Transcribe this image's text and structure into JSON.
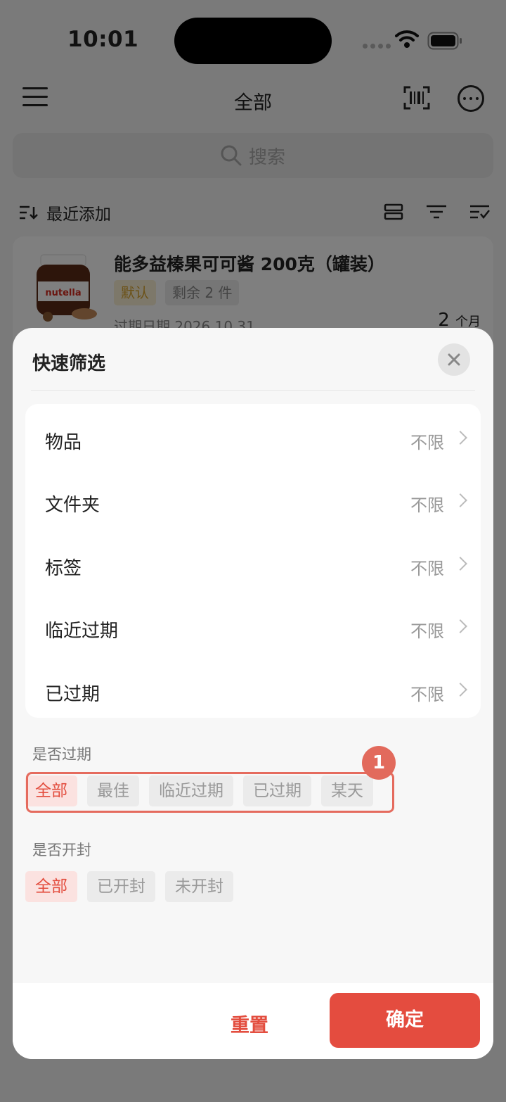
{
  "status": {
    "time": "10:01"
  },
  "nav": {
    "title": "全部"
  },
  "search": {
    "placeholder": "搜索"
  },
  "sort": {
    "label": "最近添加"
  },
  "item": {
    "title": "能多益榛果可可酱 200克（罐装）",
    "tag_default": "默认",
    "tag_remain": "剩余 2 件",
    "date": "过期日期 2026.10.31",
    "months_value": "2",
    "months_unit": "个月",
    "image_text": "nutella"
  },
  "sheet": {
    "title": "快速筛选",
    "rows": [
      {
        "label": "物品",
        "value": "不限"
      },
      {
        "label": "文件夹",
        "value": "不限"
      },
      {
        "label": "标签",
        "value": "不限"
      },
      {
        "label": "临近过期",
        "value": "不限"
      },
      {
        "label": "已过期",
        "value": "不限"
      }
    ],
    "expiry_section": {
      "label": "是否过期",
      "options": [
        "全部",
        "最佳",
        "临近过期",
        "已过期",
        "某天"
      ],
      "selected": "全部"
    },
    "opened_section": {
      "label": "是否开封",
      "options": [
        "全部",
        "已开封",
        "未开封"
      ],
      "selected": "全部"
    },
    "highlight_badge": "1",
    "reset_label": "重置",
    "confirm_label": "确定"
  },
  "colors": {
    "accent": "#e44c3f",
    "chip_active_bg": "#fbe2e0",
    "tag_default_bg": "#fbf1d4"
  }
}
